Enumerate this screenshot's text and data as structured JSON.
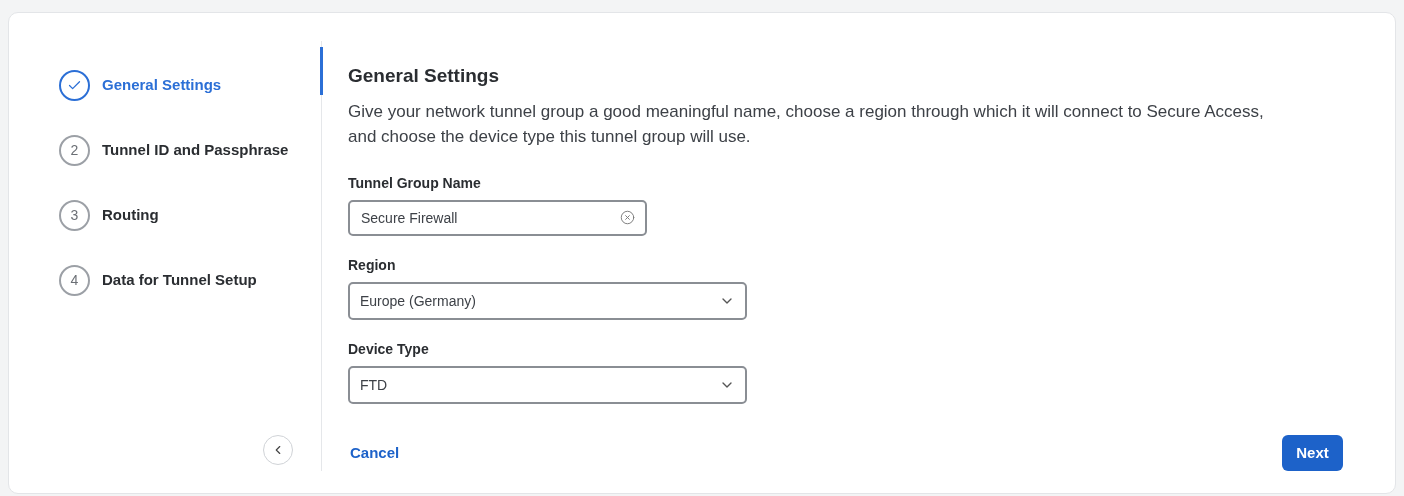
{
  "steps": [
    {
      "label": "General Settings",
      "selected": true,
      "completed": true
    },
    {
      "number": "2",
      "label": "Tunnel ID and Passphrase",
      "selected": false,
      "completed": false
    },
    {
      "number": "3",
      "label": "Routing",
      "selected": false,
      "completed": false
    },
    {
      "number": "4",
      "label": "Data for Tunnel Setup",
      "selected": false,
      "completed": false
    }
  ],
  "heading": "General Settings",
  "description": "Give your network tunnel group a good meaningful name, choose a region through which it will connect to Secure Access, and choose the device type this tunnel group will use.",
  "fields": [
    {
      "kind": "text",
      "label": "Tunnel Group Name",
      "value": "Secure Firewall"
    },
    {
      "kind": "select",
      "label": "Region",
      "value": "Europe (Germany)"
    },
    {
      "kind": "select",
      "label": "Device Type",
      "value": "FTD"
    }
  ],
  "cancel": "Cancel",
  "next": "Next"
}
